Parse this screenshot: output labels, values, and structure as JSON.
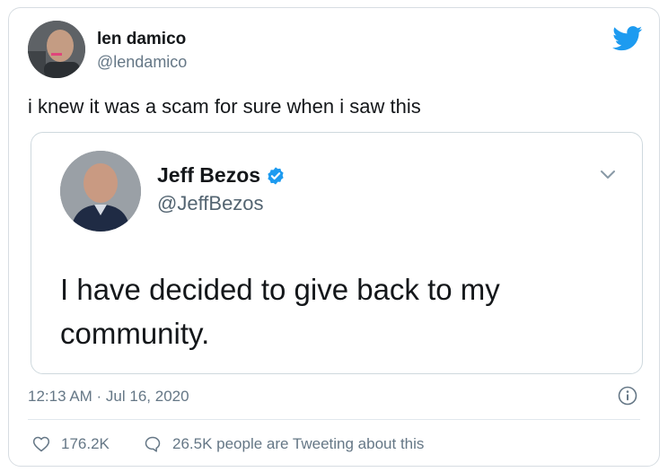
{
  "tweet": {
    "author_name": "len damico",
    "author_handle": "@lendamico",
    "text": "i knew it was a scam for sure when i saw this",
    "timestamp": "12:13 AM · Jul 16, 2020",
    "likes": "176.2K",
    "tweeting_about": "26.5K people are Tweeting about this"
  },
  "quoted": {
    "author_name": "Jeff Bezos",
    "author_handle": "@JeffBezos",
    "text": "I have decided to give back to my community."
  },
  "colors": {
    "twitter_blue": "#1d9bf0",
    "text_primary": "#14171a",
    "text_secondary": "#657786",
    "border": "#d7dde2"
  },
  "icons": [
    "twitter-bird-icon",
    "verified-badge-icon",
    "chevron-down-icon",
    "info-icon",
    "heart-icon",
    "reply-bubble-icon"
  ]
}
